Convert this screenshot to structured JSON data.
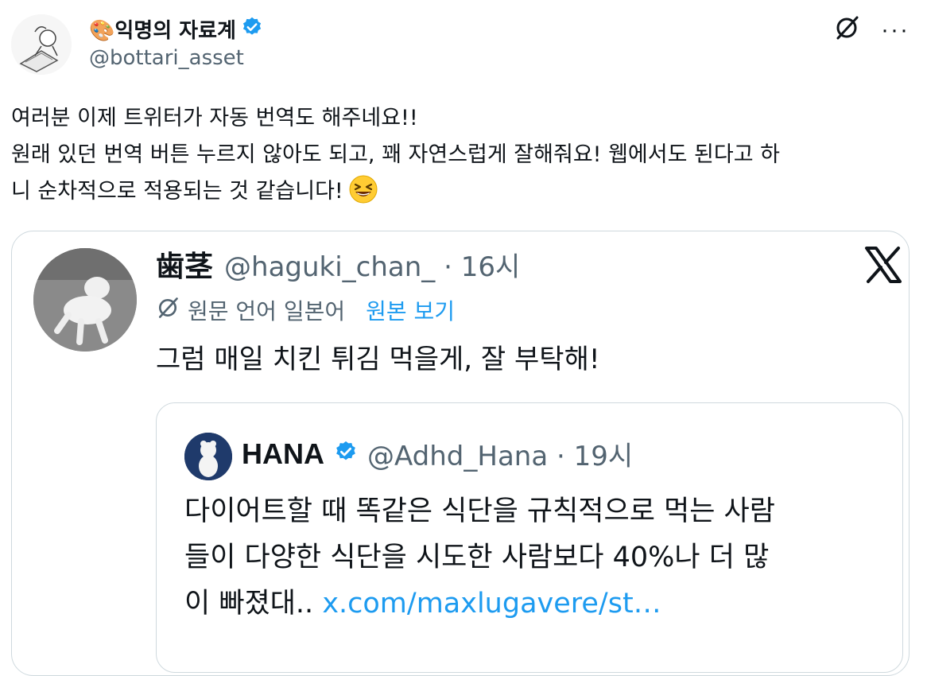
{
  "author": {
    "name": "🎨익명의 자료계",
    "handle": "@bottari_asset",
    "verified": true
  },
  "top_actions": {
    "translate_icon": "translate-slash-icon",
    "more_label": "···"
  },
  "tweet": {
    "line1": "여러분 이제 트위터가 자동 번역도 해주네요!!",
    "line2": "원래 있던 번역 버튼 누르지 않아도 되고, 꽤 자연스럽게 잘해줘요! 웹에서도 된다고 하",
    "line3": "니 순차적으로 적용되는 것 같습니다!",
    "emoji": "grinning-squinting-face-icon"
  },
  "quote": {
    "name": "歯茎",
    "handle_time": "@haguki_chan_ · 16시",
    "translation_label": "원문 언어 일본어",
    "view_original": "원본 보기",
    "text": "그럼 매일 치킨 튀김 먹을게, 잘 부탁해!"
  },
  "inner_quote": {
    "name": "HANA",
    "handle_time": "@Adhd_Hana · 19시",
    "verified": true,
    "line1": "다이어트할 때 똑같은 식단을 규칙적으로 먹는 사람",
    "line2": "들이 다양한 식단을 시도한 사람보다 40%나 더 많",
    "line3_text": "이 빠졌대.. ",
    "link": "x.com/maxlugavere/st…"
  },
  "colors": {
    "text": "#0f1419",
    "secondary": "#536471",
    "link": "#1d9bf0",
    "border": "#cfd9de",
    "verified": "#1d9bf0"
  }
}
